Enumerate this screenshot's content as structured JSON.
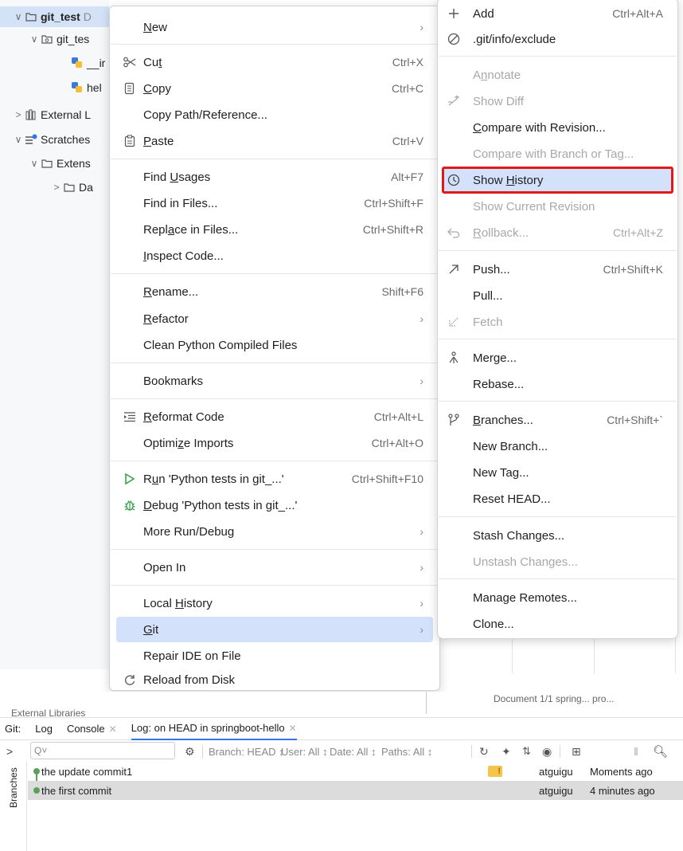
{
  "project_tree": {
    "items": [
      {
        "label": "git_test",
        "suffix": "D"
      },
      {
        "label": "git_tes"
      },
      {
        "label": "__ir"
      },
      {
        "label": "hel"
      },
      {
        "label": "External L"
      },
      {
        "label": "Scratches"
      },
      {
        "label": "Extens"
      },
      {
        "label": "Da"
      }
    ]
  },
  "context_menu": {
    "items": [
      {
        "label": "New",
        "underline": "N",
        "submenu": true,
        "icon": ""
      },
      {
        "label": "Cut",
        "underline": "t",
        "shortcut": "Ctrl+X",
        "icon": "scissors-icon"
      },
      {
        "label": "Copy",
        "underline": "C",
        "shortcut": "Ctrl+C",
        "icon": "copy-icon"
      },
      {
        "label": "Copy Path/Reference...",
        "underline": "",
        "icon": ""
      },
      {
        "label": "Paste",
        "underline": "P",
        "shortcut": "Ctrl+V",
        "icon": "paste-icon"
      },
      {
        "label": "Find Usages",
        "underline": "U",
        "shortcut": "Alt+F7",
        "icon": ""
      },
      {
        "label": "Find in Files...",
        "underline": "",
        "shortcut": "Ctrl+Shift+F",
        "icon": ""
      },
      {
        "label": "Replace in Files...",
        "underline": "a",
        "shortcut": "Ctrl+Shift+R",
        "icon": ""
      },
      {
        "label": "Inspect Code...",
        "underline": "I",
        "icon": ""
      },
      {
        "label": "Rename...",
        "underline": "R",
        "shortcut": "Shift+F6",
        "icon": ""
      },
      {
        "label": "Refactor",
        "underline": "R",
        "submenu": true,
        "icon": ""
      },
      {
        "label": "Clean Python Compiled Files",
        "underline": "",
        "icon": ""
      },
      {
        "label": "Bookmarks",
        "underline": "",
        "submenu": true,
        "icon": ""
      },
      {
        "label": "Reformat Code",
        "underline": "R",
        "shortcut": "Ctrl+Alt+L",
        "icon": "reformat-icon"
      },
      {
        "label": "Optimize Imports",
        "underline": "z",
        "shortcut": "Ctrl+Alt+O",
        "icon": ""
      },
      {
        "label": "Run 'Python tests in git_...'",
        "underline": "u",
        "shortcut": "Ctrl+Shift+F10",
        "icon": "run-icon"
      },
      {
        "label": "Debug 'Python tests in git_...'",
        "underline": "D",
        "icon": "debug-icon"
      },
      {
        "label": "More Run/Debug",
        "underline": "",
        "submenu": true,
        "icon": ""
      },
      {
        "label": "Open In",
        "underline": "",
        "submenu": true,
        "icon": ""
      },
      {
        "label": "Local History",
        "underline": "H",
        "submenu": true,
        "icon": ""
      },
      {
        "label": "Git",
        "underline": "G",
        "submenu": true,
        "icon": "",
        "active": true
      },
      {
        "label": "Repair IDE on File",
        "underline": "",
        "icon": ""
      },
      {
        "label": "Reload from Disk",
        "underline": "",
        "icon": "reload-icon"
      }
    ]
  },
  "git_submenu": {
    "items": [
      {
        "label": "Add",
        "shortcut": "Ctrl+Alt+A",
        "icon": "plus-icon"
      },
      {
        "label": ".git/info/exclude",
        "icon": "ignore-icon"
      },
      {
        "label": "Annotate",
        "disabled": true
      },
      {
        "label": "Show Diff",
        "disabled": true,
        "icon": "diff-icon"
      },
      {
        "label": "Compare with Revision...",
        "underline": "C"
      },
      {
        "label": "Compare with Branch or Tag...",
        "disabled": true
      },
      {
        "label": "Show History",
        "underline": "H",
        "icon": "history-icon",
        "highlight": true
      },
      {
        "label": "Show Current Revision",
        "disabled": true
      },
      {
        "label": "Rollback...",
        "shortcut": "Ctrl+Alt+Z",
        "disabled": true,
        "icon": "rollback-icon"
      },
      {
        "label": "Push...",
        "shortcut": "Ctrl+Shift+K",
        "icon": "push-icon"
      },
      {
        "label": "Pull..."
      },
      {
        "label": "Fetch",
        "disabled": true,
        "icon": "fetch-icon"
      },
      {
        "label": "Merge...",
        "icon": "merge-icon"
      },
      {
        "label": "Rebase..."
      },
      {
        "label": "Branches...",
        "underline": "B",
        "shortcut": "Ctrl+Shift+`",
        "icon": "branch-icon"
      },
      {
        "label": "New Branch..."
      },
      {
        "label": "New Tag..."
      },
      {
        "label": "Reset HEAD..."
      },
      {
        "label": "Stash Changes..."
      },
      {
        "label": "Unstash Changes...",
        "disabled": true
      },
      {
        "label": "Manage Remotes..."
      },
      {
        "label": "Clone..."
      }
    ]
  },
  "strip": {
    "text_left": "External Libraries",
    "text_right": "Document 1/1    spring...    pro..."
  },
  "git_window": {
    "title": "Git:",
    "tabs": [
      {
        "label": "Log",
        "closable": false
      },
      {
        "label": "Console",
        "closable": true
      },
      {
        "label": "Log: on HEAD in springboot-hello",
        "closable": true,
        "active": true
      }
    ],
    "search_placeholder": "Q˅",
    "filters": [
      "Branch: HEAD ↕",
      "User: All ↕",
      "Date: All ↕",
      "Paths: All ↕"
    ],
    "side_label": "Branches",
    "commits": [
      {
        "message": "the update commit1",
        "author": "atguigu",
        "date": "Moments ago",
        "tag": true
      },
      {
        "message": "the first commit",
        "author": "atguigu",
        "date": "4 minutes ago",
        "tag": false
      }
    ]
  },
  "colors": {
    "accent": "#3574f0",
    "selection": "#d3e1fa",
    "highlight_border": "#e01919",
    "graph": "#5aa05a"
  }
}
